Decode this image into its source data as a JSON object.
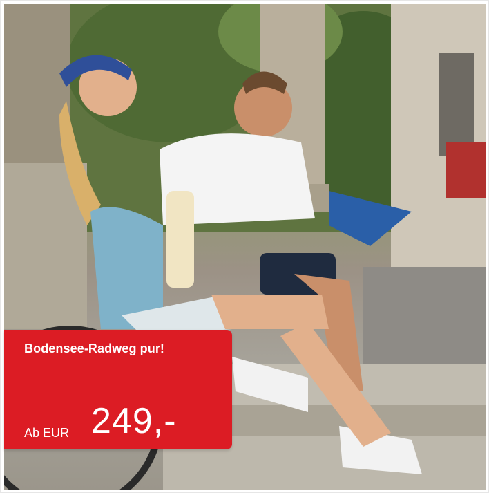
{
  "offer": {
    "title": "Bodensee-Radweg pur!",
    "price_prefix": "Ab EUR",
    "price": "249,-",
    "background_color": "#dc1c24"
  },
  "image": {
    "subject": "cyclists-resting-on-steps"
  }
}
